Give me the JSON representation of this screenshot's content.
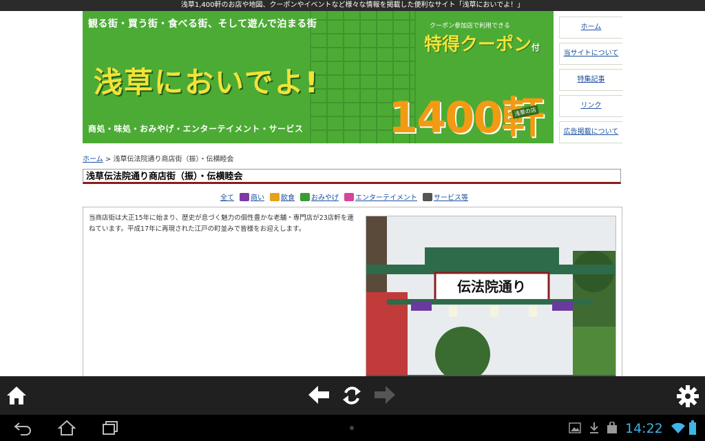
{
  "window": {
    "title": "浅草1,400軒のお店や地図、クーポンやイベントなど様々な情報を掲載した便利なサイト「浅草においでよ！」"
  },
  "banner": {
    "tagline": "観る街・買う街・食べる街、そして遊んで泊まる街",
    "logo": "浅草においでよ!",
    "subline": "商処・味処・おみやげ・エンターテイメント・サービス",
    "coupon_small": "クーポン参加店で利用できる",
    "coupon_big": "特得クーポン",
    "coupon_suffix": "付",
    "shop_count": "1400軒",
    "badge": "浅草の店"
  },
  "nav": {
    "items": [
      {
        "label": "ホーム"
      },
      {
        "label": "当サイトについて"
      },
      {
        "label": "特集記事"
      },
      {
        "label": "リンク"
      },
      {
        "label": "広告掲載について"
      }
    ]
  },
  "breadcrumb": {
    "home": "ホーム",
    "sep": ">",
    "current": "浅草伝法院通り商店街（振）・伝横睦会"
  },
  "page": {
    "title": "浅草伝法院通り商店街（振）・伝横睦会",
    "description": "当商店街は大正15年に始まり、歴史が息づく魅力の個性豊かな老舗・専門店が23店軒を連ねています。平成17年に再現された江戸の町並みで皆様をお迎えします。"
  },
  "categories": [
    {
      "label": "全て",
      "color": ""
    },
    {
      "label": "商い",
      "color": "#7a3aa5"
    },
    {
      "label": "飲食",
      "color": "#e4a21a"
    },
    {
      "label": "おみやげ",
      "color": "#3a9a3a"
    },
    {
      "label": "エンターテイメント",
      "color": "#d6459a"
    },
    {
      "label": "サービス等",
      "color": "#555555"
    }
  ],
  "photo": {
    "sign_text": "伝法院通り"
  },
  "toolbar": {
    "home_icon": "home-icon",
    "back_icon": "back-arrow-icon",
    "refresh_icon": "refresh-icon",
    "forward_icon": "forward-arrow-icon",
    "settings_icon": "gear-icon"
  },
  "system": {
    "time": "14:22"
  },
  "colors": {
    "banner_green": "#4cab35",
    "title_underline": "#8d1a1a",
    "link": "#1a4fa0",
    "clock": "#3fb4e5"
  }
}
